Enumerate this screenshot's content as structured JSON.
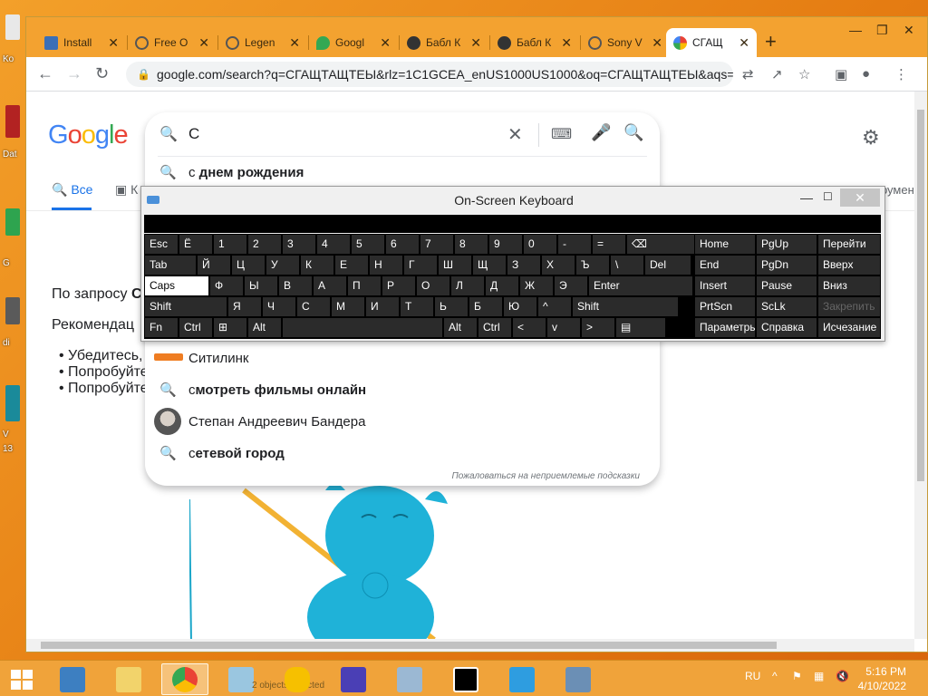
{
  "tabs": [
    {
      "label": "Install",
      "color": "#3b6fb6"
    },
    {
      "label": "Free O",
      "color": "#666666"
    },
    {
      "label": "Legen",
      "color": "#666666"
    },
    {
      "label": "Googl",
      "color": "#34a853"
    },
    {
      "label": "Бабл К",
      "color": "#333333"
    },
    {
      "label": "Бабл К",
      "color": "#333333"
    },
    {
      "label": "Sony V",
      "color": "#666666"
    },
    {
      "label": "СГАЩ",
      "color": "#4285f4"
    }
  ],
  "address": "google.com/search?q=СГАЩТАЩТЕЫ&rlz=1C1GCEA_enUS1000US1000&oq=СГАЩТАЩТЕЫ&aqs=c...",
  "google": {
    "logo": [
      "G",
      "o",
      "o",
      "g",
      "l",
      "e"
    ],
    "tab_all": "Все",
    "tab_images": "К",
    "tab_right": "Инструменты",
    "query_prefix": "По запросу ",
    "query_bold": "С",
    "recommend": "Рекомендац",
    "bullets": [
      "Убедитесь,",
      "Попробуйте",
      "Попробуйте"
    ]
  },
  "search": {
    "query": "С",
    "suggestions": [
      {
        "prefix": "с",
        "rest": " днем рождения",
        "type": "search"
      },
      {
        "prefix": "",
        "rest": "Ситилинк",
        "type": "brand"
      },
      {
        "prefix": "с",
        "rest": "мотреть фильмы онлайн",
        "type": "search"
      },
      {
        "prefix": "",
        "rest": "Степан Андреевич Бандера",
        "type": "person"
      },
      {
        "prefix": "с",
        "rest": "етевой город",
        "type": "search"
      }
    ],
    "report": "Пожаловаться на неприемлемые подсказки"
  },
  "osk": {
    "title": "On-Screen Keyboard",
    "rows": [
      [
        "Esc",
        "Ё",
        "1",
        "2",
        "3",
        "4",
        "5",
        "6",
        "7",
        "8",
        "9",
        "0",
        "-",
        "=",
        "⌫"
      ],
      [
        "Tab",
        "Й",
        "Ц",
        "У",
        "К",
        "Е",
        "Н",
        "Г",
        "Ш",
        "Щ",
        "З",
        "Х",
        "Ъ",
        "\\",
        "Del"
      ],
      [
        "Caps",
        "Ф",
        "Ы",
        "В",
        "А",
        "П",
        "Р",
        "О",
        "Л",
        "Д",
        "Ж",
        "Э",
        "Enter"
      ],
      [
        "Shift",
        "Я",
        "Ч",
        "С",
        "М",
        "И",
        "Т",
        "Ь",
        "Б",
        "Ю",
        "^",
        "Shift"
      ],
      [
        "Fn",
        "Ctrl",
        "⊞",
        "Alt",
        "",
        "Alt",
        "Ctrl",
        "<",
        "v",
        ">",
        "▤"
      ]
    ],
    "side": [
      [
        "Home",
        "PgUp",
        "Перейти"
      ],
      [
        "End",
        "PgDn",
        "Вверх"
      ],
      [
        "Insert",
        "Pause",
        "Вниз"
      ],
      [
        "PrtScn",
        "ScLk",
        "Закрепить"
      ],
      [
        "Параметры",
        "Справка",
        "Исчезание"
      ]
    ]
  },
  "taskbar": {
    "lang": "RU",
    "time": "5:16 PM",
    "date": "4/10/2022",
    "explorer_status": "2 objects selected"
  },
  "desktop_labels": [
    "Ko",
    "Dat",
    "G",
    "di",
    "V",
    "13"
  ]
}
